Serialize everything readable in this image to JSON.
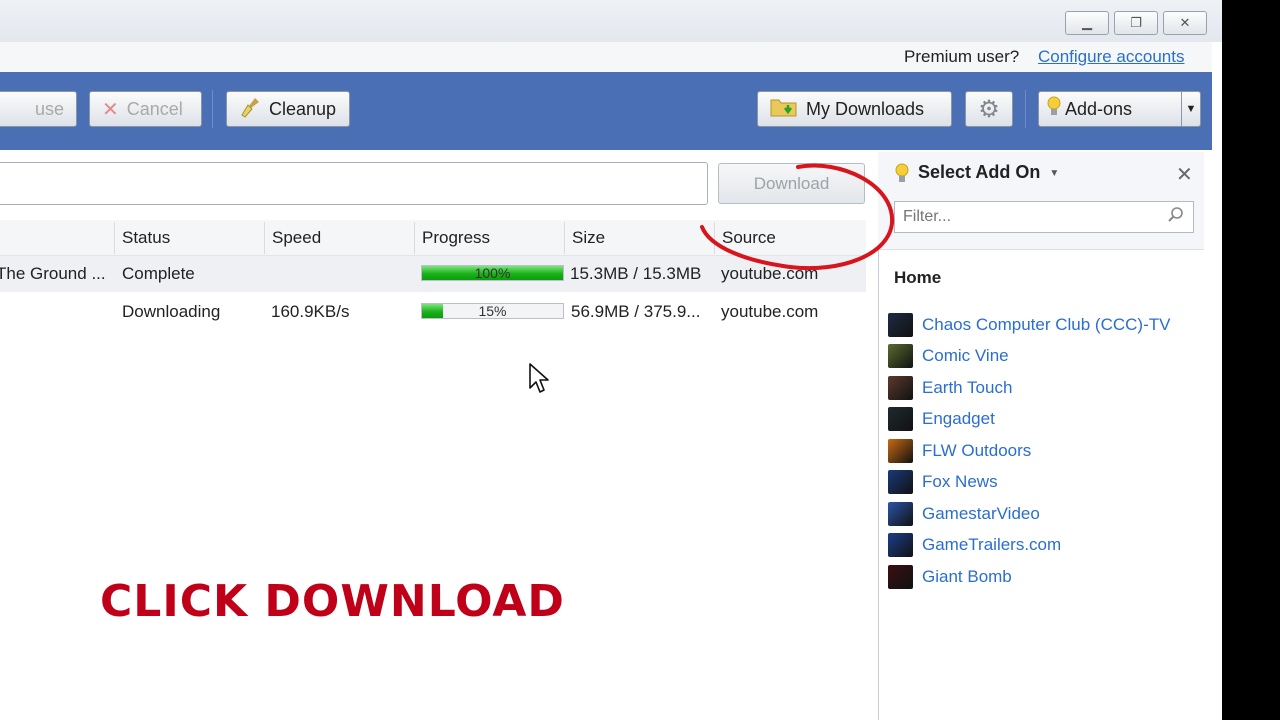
{
  "account_bar": {
    "premium_text": "Premium user?",
    "configure_link": "Configure accounts"
  },
  "toolbar": {
    "pause_label": "use",
    "cancel_label": "Cancel",
    "cleanup_label": "Cleanup",
    "my_downloads_label": "My Downloads",
    "addons_label": "Add-ons"
  },
  "url_bar": {
    "value": "",
    "download_label": "Download"
  },
  "table": {
    "headers": {
      "status": "Status",
      "speed": "Speed",
      "progress": "Progress",
      "size": "Size",
      "source": "Source"
    },
    "rows": [
      {
        "name": "The Ground ...",
        "status": "Complete",
        "speed": "",
        "progress_text": "100%",
        "progress_value": 100,
        "size": "15.3MB / 15.3MB",
        "source": "youtube.com"
      },
      {
        "name": "",
        "status": "Downloading",
        "speed": "160.9KB/s",
        "progress_text": "15%",
        "progress_value": 15,
        "size": "56.9MB / 375.9...",
        "source": "youtube.com"
      }
    ]
  },
  "addon_panel": {
    "title": "Select Add On",
    "filter_placeholder": "Filter...",
    "home_label": "Home",
    "items": [
      {
        "label": "Chaos Computer Club (CCC)-TV",
        "color": "#1c2c44"
      },
      {
        "label": "Comic Vine",
        "color": "#5a6b2e"
      },
      {
        "label": "Earth Touch",
        "color": "#5b3a2a"
      },
      {
        "label": "Engadget",
        "color": "#1f2a30"
      },
      {
        "label": "FLW Outdoors",
        "color": "#c86a12"
      },
      {
        "label": "Fox News",
        "color": "#1a3a7a"
      },
      {
        "label": "GamestarVideo",
        "color": "#2a55a8"
      },
      {
        "label": "GameTrailers.com",
        "color": "#1b3f8c"
      },
      {
        "label": "Giant Bomb",
        "color": "#3a0f12"
      }
    ]
  },
  "overlay_text": "CLICK DOWNLOAD",
  "colors": {
    "toolbar_blue": "#4a6fb5",
    "link_blue": "#2a6ed0",
    "overlay_red": "#c00018",
    "progress_green": "#19b219"
  }
}
